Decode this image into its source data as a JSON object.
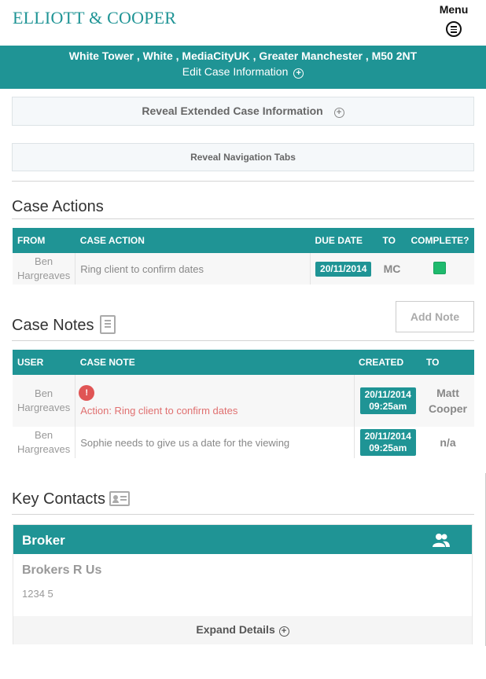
{
  "header": {
    "logo_text": "ELLIOTT & COOPER",
    "menu_label": "Menu",
    "menu_icon": "hamburger-circle-icon"
  },
  "banner": {
    "address": "White Tower , White , MediaCityUK , Greater Manchester , M50 2NT",
    "edit_label": "Edit Case Information",
    "edit_icon": "plus-circle-icon"
  },
  "reveal": {
    "extended_label": "Reveal Extended Case Information",
    "navigation_label": "Reveal Navigation Tabs"
  },
  "case_actions": {
    "title": "Case Actions",
    "headers": [
      "FROM",
      "CASE ACTION",
      "DUE DATE",
      "TO",
      "COMPLETE?"
    ],
    "rows": [
      {
        "from_line1": "Ben",
        "from_line2": "Hargreaves",
        "action": "Ring client to confirm dates",
        "due_date": "20/11/2014",
        "to": "MC",
        "complete": true
      }
    ]
  },
  "case_notes": {
    "title": "Case Notes",
    "add_note_label": "Add Note",
    "headers": [
      "USER",
      "CASE NOTE",
      "CREATED",
      "TO"
    ],
    "rows": [
      {
        "user_line1": "Ben",
        "user_line2": "Hargreaves",
        "icon": "alert-badge-icon",
        "icon_glyph": "!",
        "note": "Action: Ring client to confirm dates",
        "created_date": "20/11/2014",
        "created_time": "09:25am",
        "to_line1": "Matt",
        "to_line2": "Cooper"
      },
      {
        "user_line1": "Ben",
        "user_line2": "Hargreaves",
        "note": "Sophie needs to give us a date for the viewing",
        "created_date": "20/11/2014",
        "created_time": "09:25am",
        "to": "n/a"
      }
    ]
  },
  "key_contacts": {
    "title": "Key Contacts",
    "card": {
      "heading": "Broker",
      "name": "Brokers R Us",
      "number": "1234 5",
      "expand_label": "Expand Details"
    }
  },
  "colors": {
    "accent": "#1f9495",
    "complete": "#1fba6d",
    "alert": "#e05555"
  }
}
